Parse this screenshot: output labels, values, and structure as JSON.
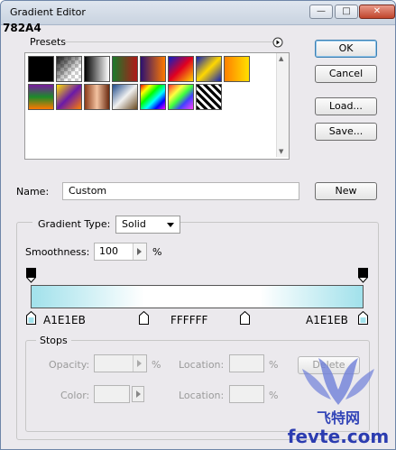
{
  "window": {
    "title": "Gradient Editor",
    "subtitle": "782A4",
    "min_glyph": "—",
    "max_glyph": "□",
    "close_glyph": "✕"
  },
  "presets": {
    "label": "Presets",
    "swatches": [
      {
        "name": "black-swatch",
        "bg": "#000000"
      },
      {
        "name": "checker-swatch",
        "bg": "checker"
      },
      {
        "name": "black-white-swatch",
        "bg": "linear-gradient(to right,#000,#fff)"
      },
      {
        "name": "red-green-swatch",
        "bg": "linear-gradient(to right,#1a7a2a,#b01818)"
      },
      {
        "name": "violet-orange-swatch",
        "bg": "linear-gradient(to right,#2c1070,#ff7a00)"
      },
      {
        "name": "blue-red-yellow-swatch",
        "bg": "linear-gradient(135deg,#0820c8,#e00020 50%,#ffd400)"
      },
      {
        "name": "blue-yellow-blue-swatch",
        "bg": "linear-gradient(135deg,#1020b8,#ffd800 50%,#1020b8)"
      },
      {
        "name": "orange-yellow-swatch",
        "bg": "linear-gradient(to right,#ff8000,#ffe000)"
      },
      {
        "name": "violet-green-orange-swatch",
        "bg": "linear-gradient(to bottom,#7a1aa0,#1c8a2a 50%,#ff7800)"
      },
      {
        "name": "yellow-violet-orange-swatch",
        "bg": "linear-gradient(135deg,#ffe000,#6a1aa8 50%,#ff8000)"
      },
      {
        "name": "copper-swatch",
        "bg": "linear-gradient(to right,#8a3a18,#f3c2a0 50%,#6a2a10)"
      },
      {
        "name": "chrome-swatch",
        "bg": "linear-gradient(135deg,#1e4a8a,#f0f0f0 50%,#6a4a20)"
      },
      {
        "name": "spectrum-swatch",
        "bg": "linear-gradient(135deg,#ff0000,#ffff00 20%,#00ff00 40%,#00ffff 60%,#0000ff 80%,#ff00ff)"
      },
      {
        "name": "transparent-rainbow-swatch",
        "bg": "linear-gradient(135deg,#ff3030,#ffff40 30%,#40ff40 50%,#4040ff 70%,#ff40ff)"
      },
      {
        "name": "stripes-swatch",
        "bg": "repeating-linear-gradient(45deg,#000 0 3px,#fff 3px 6px)"
      }
    ]
  },
  "preset_menu_icon": "right-arrow-circle-icon",
  "buttons": {
    "ok": "OK",
    "cancel": "Cancel",
    "load": "Load...",
    "save": "Save...",
    "new": "New",
    "delete": "Delete"
  },
  "name_field": {
    "label": "Name:",
    "value": "Custom"
  },
  "gradient": {
    "type_label": "Gradient Type:",
    "type_value": "Solid",
    "smoothness_label": "Smoothness:",
    "smoothness_value": "100",
    "smoothness_unit": "%",
    "stops": [
      {
        "color": "#A1E1EB",
        "label": "A1E1EB",
        "location": 0
      },
      {
        "color": "#FFFFFF",
        "label": "FFFFFF",
        "location": 34
      },
      {
        "color": "#FFFFFF",
        "label": "",
        "location": 69
      },
      {
        "color": "#A1E1EB",
        "label": "A1E1EB",
        "location": 100
      }
    ]
  },
  "stops_group": {
    "title": "Stops",
    "opacity_label": "Opacity:",
    "opacity_unit": "%",
    "location_label": "Location:",
    "location_unit": "%",
    "color_label": "Color:",
    "location2_label": "Location:",
    "location2_unit": "%"
  },
  "watermark": {
    "text1": "飞特网",
    "text2": "fevte.com"
  }
}
